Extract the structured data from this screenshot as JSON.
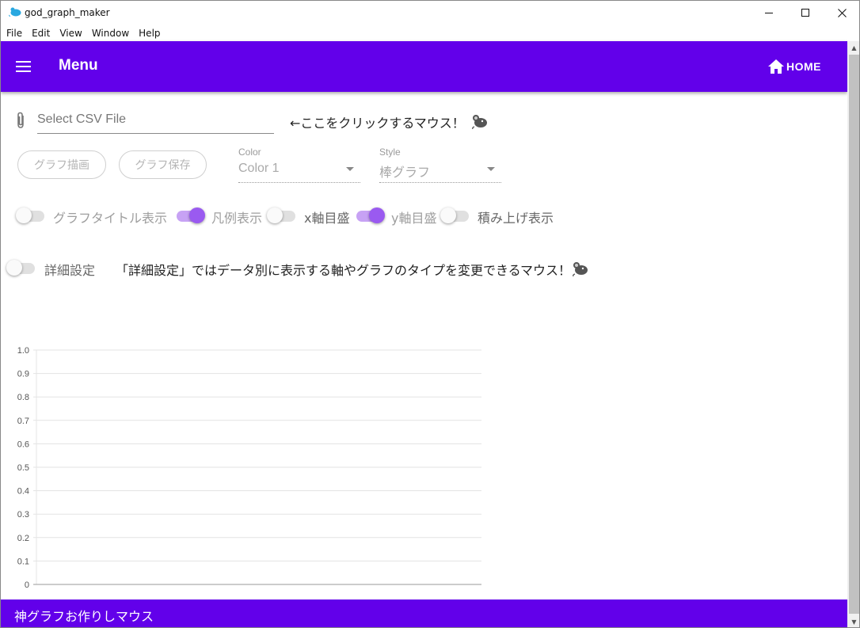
{
  "window": {
    "title": "god_graph_maker",
    "icon": "mouse-app-icon",
    "controls": [
      "minimize-icon",
      "maximize-icon",
      "close-icon"
    ]
  },
  "menubar": {
    "items": [
      "File",
      "Edit",
      "View",
      "Window",
      "Help"
    ]
  },
  "appbar": {
    "title": "Menu",
    "home_label": "HOME",
    "color": "#6200ea"
  },
  "file": {
    "placeholder": "Select CSV File",
    "value": "",
    "hint": "←ここをクリックするマウス！"
  },
  "buttons": {
    "draw": "グラフ描画",
    "save": "グラフ保存"
  },
  "color_select": {
    "label": "Color",
    "value": "Color 1"
  },
  "style_select": {
    "label": "Style",
    "value": "棒グラフ"
  },
  "toggles": [
    {
      "label": "グラフタイトル表示",
      "on": false
    },
    {
      "label": "凡例表示",
      "on": true
    },
    {
      "label": "x軸目盛",
      "on": false
    },
    {
      "label": "y軸目盛",
      "on": true
    },
    {
      "label": "積み上げ表示",
      "on": false
    }
  ],
  "detail": {
    "label": "詳細設定",
    "on": false,
    "hint": "「詳細設定」ではデータ別に表示する軸やグラフのタイプを変更できるマウス！"
  },
  "chart_data": {
    "type": "bar",
    "categories": [],
    "series": [],
    "ylim": [
      0,
      1.0
    ],
    "yticks": [
      "0",
      "0.1",
      "0.2",
      "0.3",
      "0.4",
      "0.5",
      "0.6",
      "0.7",
      "0.8",
      "0.9",
      "1.0"
    ],
    "grid": true
  },
  "footer": {
    "text": "神グラフお作りしマウス"
  },
  "colors": {
    "accent": "#6200ea",
    "switch_on_thumb": "#9a5af0",
    "switch_on_track": "#c7a2f4"
  }
}
